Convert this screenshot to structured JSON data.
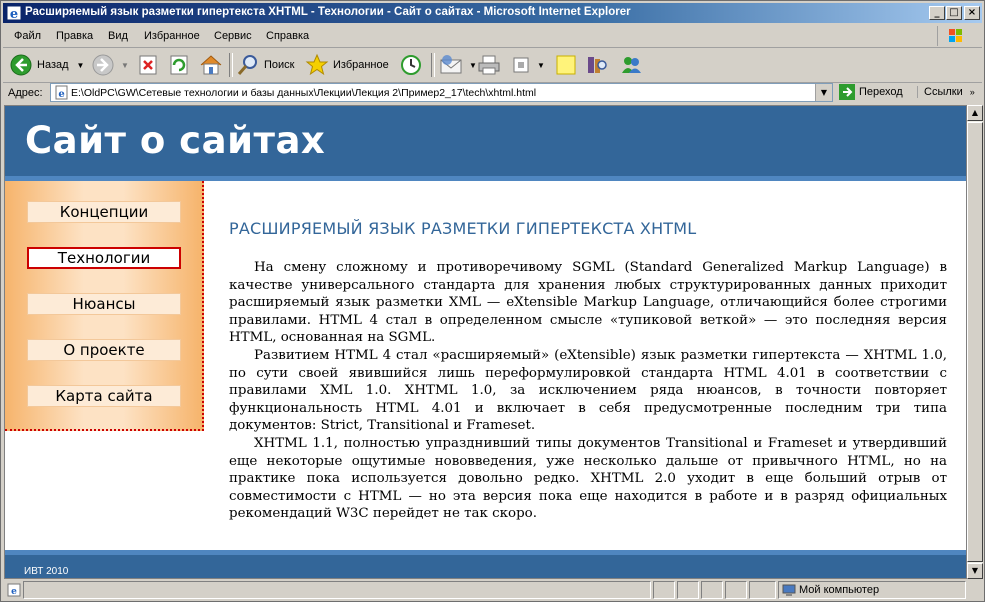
{
  "window": {
    "title": "Расширяемый язык разметки гипертекста XHTML - Технологии - Сайт о сайтах - Microsoft Internet Explorer",
    "controls": {
      "minimize": "_",
      "maximize": "□",
      "close": "×"
    }
  },
  "menu": [
    {
      "label": "Файл"
    },
    {
      "label": "Правка"
    },
    {
      "label": "Вид"
    },
    {
      "label": "Избранное"
    },
    {
      "label": "Сервис"
    },
    {
      "label": "Справка"
    }
  ],
  "toolbar": {
    "back_label": "Назад",
    "search_label": "Поиск",
    "favorites_label": "Избранное"
  },
  "address": {
    "label": "Адрес:",
    "url": "E:\\OldPC\\GW\\Сетевые технологии и базы данных\\Лекции\\Лекция 2\\Пример2_17\\tech\\xhtml.html",
    "go_label": "Переход",
    "links_label": "Ссылки"
  },
  "page": {
    "site_title": "Сайт о сайтах",
    "nav": [
      {
        "label": "Концепции",
        "active": false
      },
      {
        "label": "Технологии",
        "active": true
      },
      {
        "label": "Нюансы",
        "active": false
      },
      {
        "label": "О проекте",
        "active": false
      },
      {
        "label": "Карта сайта",
        "active": false
      }
    ],
    "heading": "РАСШИРЯЕМЫЙ ЯЗЫК РАЗМЕТКИ ГИПЕРТЕКСТА XHTML",
    "paragraphs": [
      "На смену сложному и противоречивому SGML (Standard Generalized Markup Language) в качестве универсального стандарта для хранения любых структурированных данных приходит расширяемый язык разметки XML — eXtensible Markup Language, отличающийся более строгими правилами. HTML 4 стал в определенном смысле «тупиковой веткой» — это последняя версия HTML, основанная на SGML.",
      "Развитием HTML 4 стал «расширяемый» (eXtensible) язык разметки гипертекста — XHTML 1.0, по сути своей явившийся лишь переформулировкой стандарта HTML 4.01 в соответствии с правилами XML 1.0. XHTML 1.0, за исключением ряда нюансов, в точности повторяет функциональность HTML 4.01 и включает в себя предусмотренные последним три типа документов: Strict, Transitional и Frameset.",
      "XHTML 1.1, полностью упразднивший типы документов Transitional и Frameset и утвердивший еще некоторые ощутимые нововведения, уже несколько дальше от привычного HTML, но на практике пока используется довольно редко. XHTML 2.0 уходит в еще больший отрыв от совместимости с HTML — но эта версия пока еще находится в работе и в разряд официальных рекомендаций W3C перейдет не так скоро."
    ],
    "footer": "ИВТ 2010"
  },
  "status": {
    "zone": "Мой компьютер"
  },
  "colors": {
    "header_bg": "#336699",
    "accent": "#cc0000",
    "heading": "#336699",
    "sidebar": "#f6b46c"
  }
}
